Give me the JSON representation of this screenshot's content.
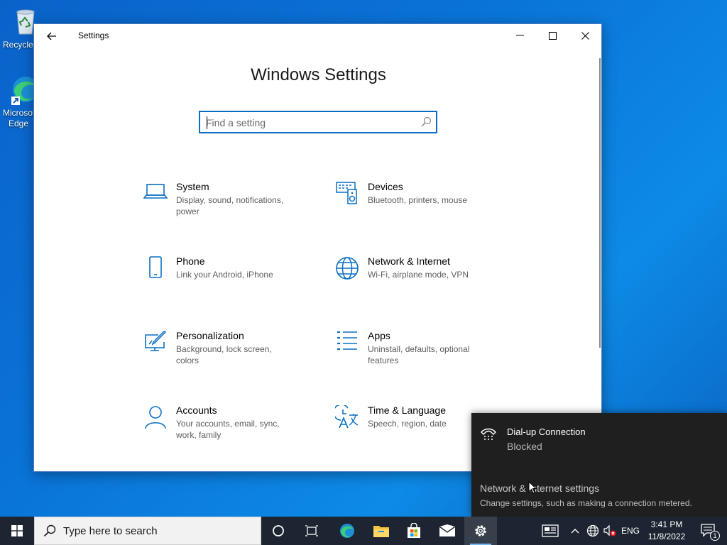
{
  "desktop": {
    "icons": [
      {
        "label": "Recycle Bin",
        "icon": "recycle-bin-icon"
      },
      {
        "label": "Microsoft Edge",
        "icon": "edge-icon"
      }
    ]
  },
  "window": {
    "title": "Settings",
    "heading": "Windows Settings",
    "search": {
      "placeholder": "Find a setting",
      "value": ""
    },
    "categories": [
      {
        "name": "System",
        "description": "Display, sound, notifications, power",
        "icon": "laptop-icon"
      },
      {
        "name": "Devices",
        "description": "Bluetooth, printers, mouse",
        "icon": "devices-icon"
      },
      {
        "name": "Phone",
        "description": "Link your Android, iPhone",
        "icon": "phone-icon"
      },
      {
        "name": "Network & Internet",
        "description": "Wi-Fi, airplane mode, VPN",
        "icon": "globe-icon"
      },
      {
        "name": "Personalization",
        "description": "Background, lock screen, colors",
        "icon": "personalization-icon"
      },
      {
        "name": "Apps",
        "description": "Uninstall, defaults, optional features",
        "icon": "apps-list-icon"
      },
      {
        "name": "Accounts",
        "description": "Your accounts, email, sync, work, family",
        "icon": "person-icon"
      },
      {
        "name": "Time & Language",
        "description": "Speech, region, date",
        "icon": "time-language-icon"
      }
    ]
  },
  "network_flyout": {
    "connection_name": "Dial-up Connection",
    "connection_status": "Blocked",
    "settings_link": "Network & Internet settings",
    "settings_sub": "Change settings, such as making a connection metered."
  },
  "taskbar": {
    "search_placeholder": "Type here to search",
    "apps": [
      "cortana-icon",
      "task-view-icon",
      "edge-icon",
      "file-explorer-icon",
      "store-icon",
      "mail-icon",
      "settings-gear-icon"
    ],
    "language": "ENG",
    "time": "3:41 PM",
    "date": "11/8/2022",
    "notification_count": "1"
  },
  "colors": {
    "accent": "#0a6fc2",
    "desktop": "#0a74d8",
    "taskbar": "#1c2531",
    "flyout": "#1f1f1f"
  }
}
